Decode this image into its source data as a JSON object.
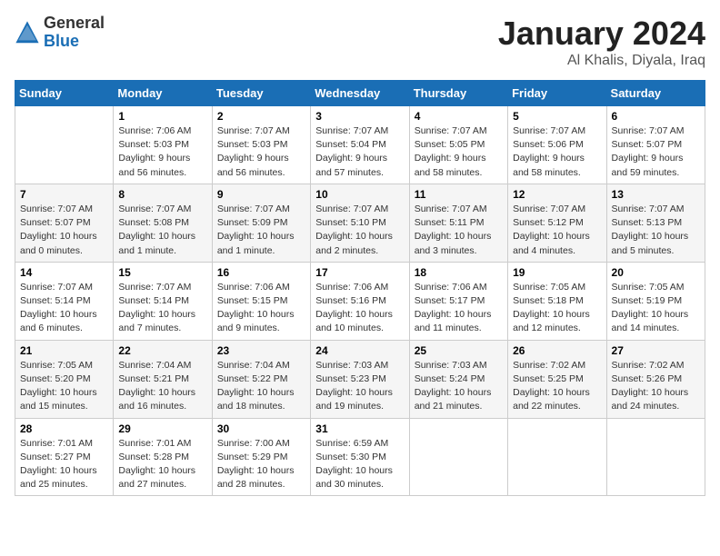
{
  "header": {
    "logo_general": "General",
    "logo_blue": "Blue",
    "title": "January 2024",
    "subtitle": "Al Khalis, Diyala, Iraq"
  },
  "days_of_week": [
    "Sunday",
    "Monday",
    "Tuesday",
    "Wednesday",
    "Thursday",
    "Friday",
    "Saturday"
  ],
  "weeks": [
    [
      {
        "num": "",
        "info": ""
      },
      {
        "num": "1",
        "info": "Sunrise: 7:06 AM\nSunset: 5:03 PM\nDaylight: 9 hours\nand 56 minutes."
      },
      {
        "num": "2",
        "info": "Sunrise: 7:07 AM\nSunset: 5:03 PM\nDaylight: 9 hours\nand 56 minutes."
      },
      {
        "num": "3",
        "info": "Sunrise: 7:07 AM\nSunset: 5:04 PM\nDaylight: 9 hours\nand 57 minutes."
      },
      {
        "num": "4",
        "info": "Sunrise: 7:07 AM\nSunset: 5:05 PM\nDaylight: 9 hours\nand 58 minutes."
      },
      {
        "num": "5",
        "info": "Sunrise: 7:07 AM\nSunset: 5:06 PM\nDaylight: 9 hours\nand 58 minutes."
      },
      {
        "num": "6",
        "info": "Sunrise: 7:07 AM\nSunset: 5:07 PM\nDaylight: 9 hours\nand 59 minutes."
      }
    ],
    [
      {
        "num": "7",
        "info": "Sunrise: 7:07 AM\nSunset: 5:07 PM\nDaylight: 10 hours\nand 0 minutes."
      },
      {
        "num": "8",
        "info": "Sunrise: 7:07 AM\nSunset: 5:08 PM\nDaylight: 10 hours\nand 1 minute."
      },
      {
        "num": "9",
        "info": "Sunrise: 7:07 AM\nSunset: 5:09 PM\nDaylight: 10 hours\nand 1 minute."
      },
      {
        "num": "10",
        "info": "Sunrise: 7:07 AM\nSunset: 5:10 PM\nDaylight: 10 hours\nand 2 minutes."
      },
      {
        "num": "11",
        "info": "Sunrise: 7:07 AM\nSunset: 5:11 PM\nDaylight: 10 hours\nand 3 minutes."
      },
      {
        "num": "12",
        "info": "Sunrise: 7:07 AM\nSunset: 5:12 PM\nDaylight: 10 hours\nand 4 minutes."
      },
      {
        "num": "13",
        "info": "Sunrise: 7:07 AM\nSunset: 5:13 PM\nDaylight: 10 hours\nand 5 minutes."
      }
    ],
    [
      {
        "num": "14",
        "info": "Sunrise: 7:07 AM\nSunset: 5:14 PM\nDaylight: 10 hours\nand 6 minutes."
      },
      {
        "num": "15",
        "info": "Sunrise: 7:07 AM\nSunset: 5:14 PM\nDaylight: 10 hours\nand 7 minutes."
      },
      {
        "num": "16",
        "info": "Sunrise: 7:06 AM\nSunset: 5:15 PM\nDaylight: 10 hours\nand 9 minutes."
      },
      {
        "num": "17",
        "info": "Sunrise: 7:06 AM\nSunset: 5:16 PM\nDaylight: 10 hours\nand 10 minutes."
      },
      {
        "num": "18",
        "info": "Sunrise: 7:06 AM\nSunset: 5:17 PM\nDaylight: 10 hours\nand 11 minutes."
      },
      {
        "num": "19",
        "info": "Sunrise: 7:05 AM\nSunset: 5:18 PM\nDaylight: 10 hours\nand 12 minutes."
      },
      {
        "num": "20",
        "info": "Sunrise: 7:05 AM\nSunset: 5:19 PM\nDaylight: 10 hours\nand 14 minutes."
      }
    ],
    [
      {
        "num": "21",
        "info": "Sunrise: 7:05 AM\nSunset: 5:20 PM\nDaylight: 10 hours\nand 15 minutes."
      },
      {
        "num": "22",
        "info": "Sunrise: 7:04 AM\nSunset: 5:21 PM\nDaylight: 10 hours\nand 16 minutes."
      },
      {
        "num": "23",
        "info": "Sunrise: 7:04 AM\nSunset: 5:22 PM\nDaylight: 10 hours\nand 18 minutes."
      },
      {
        "num": "24",
        "info": "Sunrise: 7:03 AM\nSunset: 5:23 PM\nDaylight: 10 hours\nand 19 minutes."
      },
      {
        "num": "25",
        "info": "Sunrise: 7:03 AM\nSunset: 5:24 PM\nDaylight: 10 hours\nand 21 minutes."
      },
      {
        "num": "26",
        "info": "Sunrise: 7:02 AM\nSunset: 5:25 PM\nDaylight: 10 hours\nand 22 minutes."
      },
      {
        "num": "27",
        "info": "Sunrise: 7:02 AM\nSunset: 5:26 PM\nDaylight: 10 hours\nand 24 minutes."
      }
    ],
    [
      {
        "num": "28",
        "info": "Sunrise: 7:01 AM\nSunset: 5:27 PM\nDaylight: 10 hours\nand 25 minutes."
      },
      {
        "num": "29",
        "info": "Sunrise: 7:01 AM\nSunset: 5:28 PM\nDaylight: 10 hours\nand 27 minutes."
      },
      {
        "num": "30",
        "info": "Sunrise: 7:00 AM\nSunset: 5:29 PM\nDaylight: 10 hours\nand 28 minutes."
      },
      {
        "num": "31",
        "info": "Sunrise: 6:59 AM\nSunset: 5:30 PM\nDaylight: 10 hours\nand 30 minutes."
      },
      {
        "num": "",
        "info": ""
      },
      {
        "num": "",
        "info": ""
      },
      {
        "num": "",
        "info": ""
      }
    ]
  ]
}
